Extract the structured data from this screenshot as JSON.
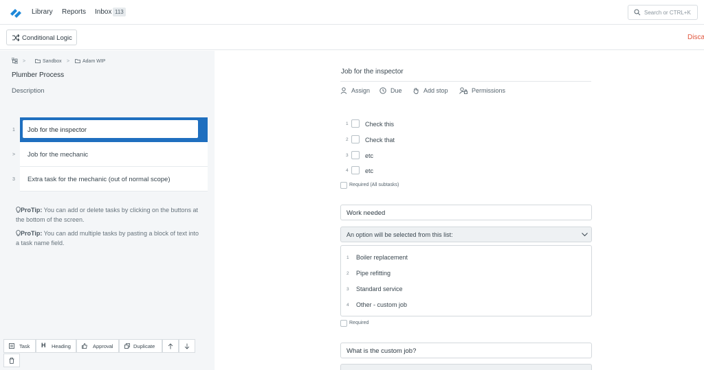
{
  "nav": {
    "library": "Library",
    "reports": "Reports",
    "inbox": "Inbox",
    "inbox_count": "113",
    "search_placeholder": "Search or CTRL+K"
  },
  "toolbar": {
    "conditional_logic": "Conditional Logic",
    "discard": "Disca"
  },
  "breadcrumb": {
    "sep": ">",
    "sandbox": "Sandbox",
    "folder": "Adam WIP"
  },
  "process": {
    "title": "Plumber Process",
    "description": "Description"
  },
  "tasks": [
    {
      "num": "1",
      "label": "Job for the inspector"
    },
    {
      "num": ">",
      "label": "Job for the mechanic"
    },
    {
      "num": "3",
      "label": "Extra task for the mechanic (out of normal scope)"
    }
  ],
  "protips": [
    {
      "head": "ProTip:",
      "text": " You can add or delete tasks by clicking on the buttons at the bottom of the screen."
    },
    {
      "head": "ProTip:",
      "text": " You can add multiple tasks by pasting a block of text into a task name field."
    }
  ],
  "bottom_buttons": {
    "task": "Task",
    "heading": "Heading",
    "approval": "Approval",
    "duplicate": "Duplicate"
  },
  "main": {
    "task_title": "Job for the inspector",
    "actions": {
      "assign": "Assign",
      "due": "Due",
      "add_stop": "Add stop",
      "permissions": "Permissions"
    },
    "subtasks": [
      {
        "num": "1",
        "label": "Check this"
      },
      {
        "num": "2",
        "label": "Check that"
      },
      {
        "num": "3",
        "label": "etc"
      },
      {
        "num": "4",
        "label": "etc"
      }
    ],
    "required_all": "Required (All subtasks)",
    "work_needed": "Work needed",
    "dropdown_label": "An option will be selected from this list:",
    "options": [
      {
        "num": "1",
        "label": "Boiler replacement"
      },
      {
        "num": "2",
        "label": "Pipe refitting"
      },
      {
        "num": "3",
        "label": "Standard service"
      },
      {
        "num": "4",
        "label": "Other - custom job"
      }
    ],
    "required": "Required",
    "custom_job_question": "What is the custom job?"
  },
  "colors": {
    "accent": "#1f6fbf",
    "logo": "#1e88d8",
    "discard": "#e0533a"
  }
}
